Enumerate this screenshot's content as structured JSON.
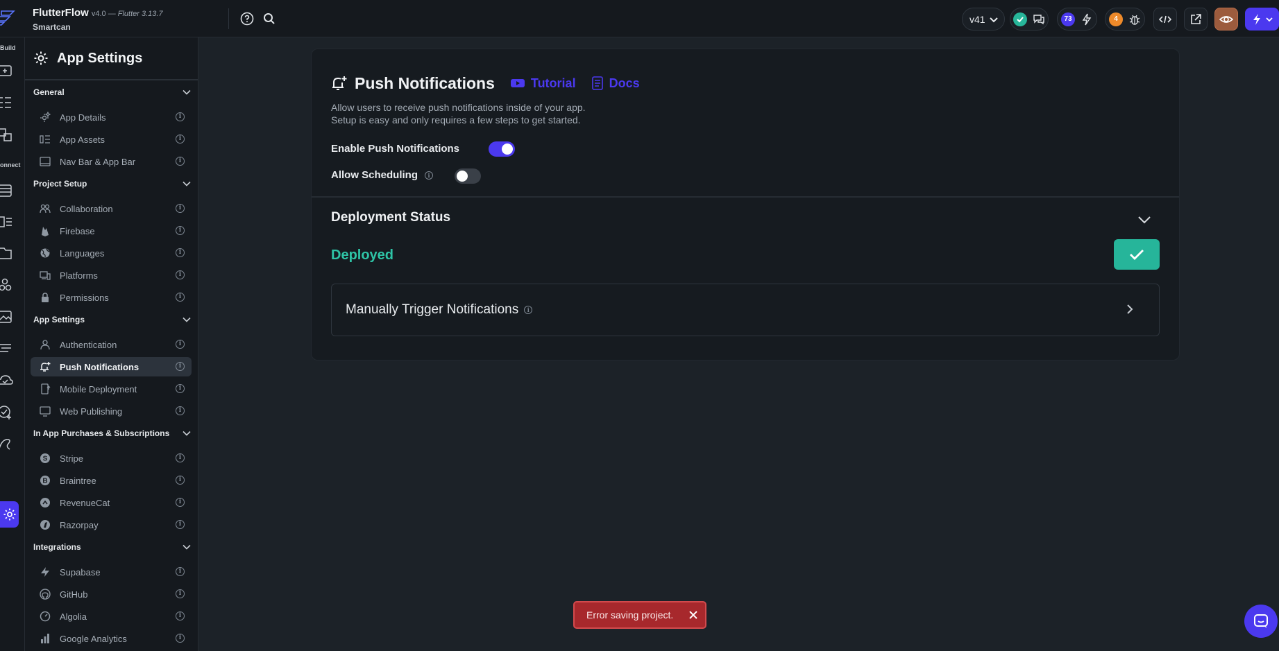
{
  "app": {
    "name": "FlutterFlow",
    "version": "v4.0",
    "flutter": "— Flutter 3.13.7",
    "project": "Smartcan"
  },
  "topbar": {
    "version_label": "v41",
    "badge_count": "73",
    "bug_count": "4"
  },
  "rail": {
    "build_label": "Build",
    "connect_label": "onnect"
  },
  "sidebar": {
    "title": "App Settings",
    "sections": [
      {
        "label": "General",
        "items": [
          "App Details",
          "App Assets",
          "Nav Bar & App Bar"
        ]
      },
      {
        "label": "Project Setup",
        "items": [
          "Collaboration",
          "Firebase",
          "Languages",
          "Platforms",
          "Permissions"
        ]
      },
      {
        "label": "App Settings",
        "items": [
          "Authentication",
          "Push Notifications",
          "Mobile Deployment",
          "Web Publishing"
        ]
      },
      {
        "label": "In App Purchases & Subscriptions",
        "items": [
          "Stripe",
          "Braintree",
          "RevenueCat",
          "Razorpay"
        ]
      },
      {
        "label": "Integrations",
        "items": [
          "Supabase",
          "GitHub",
          "Algolia",
          "Google Analytics"
        ]
      }
    ]
  },
  "main": {
    "title": "Push Notifications",
    "tutorial_label": "Tutorial",
    "docs_label": "Docs",
    "description_line1": "Allow users to receive push notifications inside of your app.",
    "description_line2": "Setup is easy and only requires a few steps to get started.",
    "enable_label": "Enable Push Notifications",
    "enable_on": true,
    "scheduling_label": "Allow Scheduling",
    "scheduling_on": false,
    "deployment_title": "Deployment Status",
    "deployed_label": "Deployed",
    "trigger_label": "Manually Trigger Notifications"
  },
  "toast": {
    "message": "Error saving project."
  },
  "colors": {
    "accent": "#4b39ef",
    "success": "#2ec4a6",
    "error": "#a7282c"
  }
}
